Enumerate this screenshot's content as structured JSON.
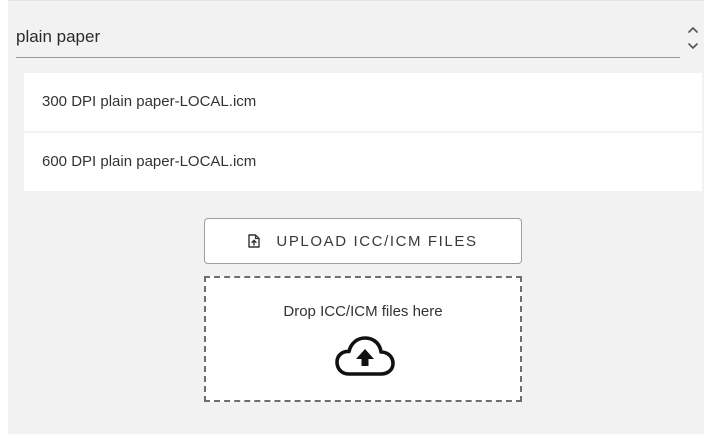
{
  "profile_select": {
    "value": "plain paper",
    "arrow_icon": "chevron-up-down-icon"
  },
  "profile_list": {
    "items": [
      {
        "label": "300 DPI plain paper-LOCAL.icm"
      },
      {
        "label": "600 DPI plain paper-LOCAL.icm"
      }
    ]
  },
  "upload": {
    "button_label": "UPLOAD ICC/ICM FILES",
    "button_icon": "file-upload-icon",
    "drop_text": "Drop ICC/ICM files here",
    "drop_icon": "cloud-upload-icon"
  },
  "colors": {
    "panel_background": "#f2f2f2",
    "item_background": "#ffffff",
    "border": "#9e9e9e"
  }
}
